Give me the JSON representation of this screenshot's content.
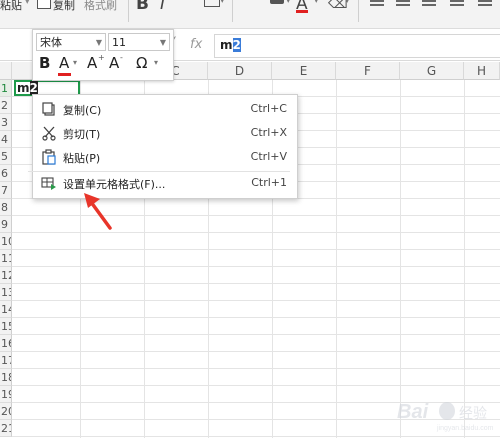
{
  "ribbon": {
    "paste_label": "粘贴",
    "copy_label": "复制",
    "format_painter_label": "格式刷",
    "bold_glyph": "B",
    "italic_glyph": "I",
    "font_color_glyph": "A"
  },
  "formula_bar": {
    "fx_label": "fx",
    "value": "m",
    "value_selected": "2"
  },
  "mini_toolbar": {
    "font_name": "宋体",
    "font_size": "11",
    "bold_glyph": "B",
    "font_color_glyph": "A",
    "grow_glyph": "A",
    "shrink_glyph": "A",
    "special_glyph": "Ω"
  },
  "sheet": {
    "columns": [
      "C",
      "D",
      "E",
      "F",
      "G",
      "H"
    ],
    "rows": [
      "1",
      "2",
      "3",
      "4",
      "5",
      "6",
      "7",
      "8",
      "9",
      "10",
      "11",
      "12",
      "13",
      "14",
      "15",
      "16",
      "17",
      "18",
      "19",
      "20",
      "21"
    ],
    "active_row": "1",
    "a1": {
      "text": "m",
      "sup": "2"
    }
  },
  "context_menu": {
    "items": [
      {
        "label": "复制(C)",
        "shortcut": "Ctrl+C",
        "icon": "copy-icon"
      },
      {
        "label": "剪切(T)",
        "shortcut": "Ctrl+X",
        "icon": "cut-icon"
      },
      {
        "label": "粘贴(P)",
        "shortcut": "Ctrl+V",
        "icon": "paste-icon"
      },
      {
        "label": "设置单元格格式(F)...",
        "shortcut": "Ctrl+1",
        "icon": "format-cells-icon"
      }
    ]
  },
  "colors": {
    "selection_green": "#1e9a4a",
    "highlight_blue": "#3a7cd9",
    "arrow_red": "#e8352a",
    "font_color_red": "#e02020"
  }
}
